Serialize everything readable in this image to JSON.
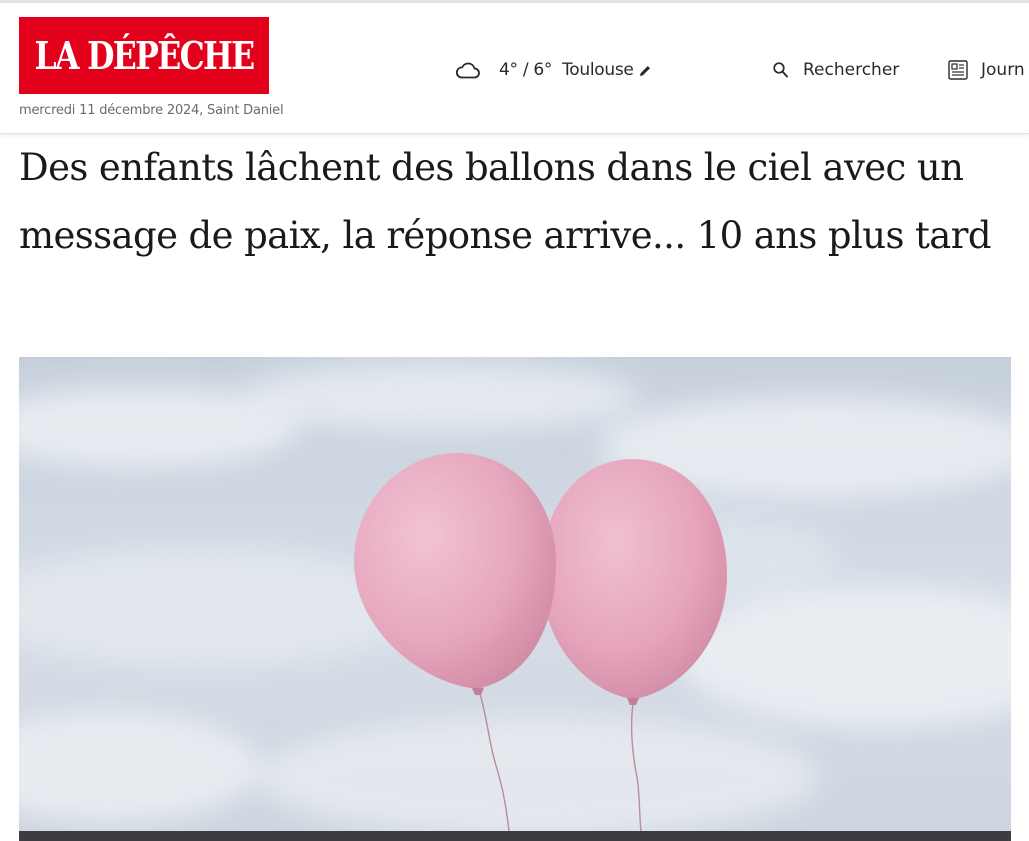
{
  "header": {
    "logo_text": "LA DÉPÊCHE",
    "date_line": "mercredi 11 décembre 2024, Saint Daniel",
    "weather": {
      "icon": "cloud-icon",
      "temperature": "4° / 6°",
      "city": "Toulouse",
      "edit_icon": "pencil-icon"
    },
    "search": {
      "icon": "search-icon",
      "label": "Rechercher"
    },
    "journal": {
      "icon": "newspaper-icon",
      "label": "Journ"
    }
  },
  "article": {
    "headline": "Des enfants lâchent des ballons dans le ciel avec un message de paix, la réponse arrive... 10 ans plus tard"
  },
  "colors": {
    "brand_red": "#e2001a",
    "balloon_pink": "#e7a9bf",
    "sky": "#c9d3dd"
  }
}
